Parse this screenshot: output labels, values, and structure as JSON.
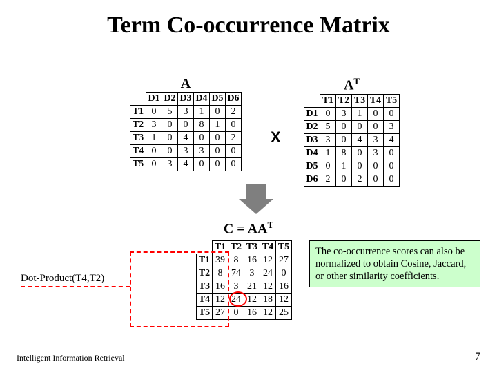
{
  "title": "Term Co-occurrence Matrix",
  "labels": {
    "A": "A",
    "AT_html": "A",
    "AT_sup": "T",
    "x": "X",
    "C_prefix": "C =  A",
    "C_middle": "A",
    "C_sup": "T",
    "dotprod": "Dot-Product(T4,T2)",
    "note": "The co-occurrence scores can also be normalized to obtain Cosine, Jaccard, or other similarity coefficients.",
    "footer_left": "Intelligent Information Retrieval",
    "footer_right": "7"
  },
  "matrixA": {
    "col_headers": [
      "D1",
      "D2",
      "D3",
      "D4",
      "D5",
      "D6"
    ],
    "row_headers": [
      "T1",
      "T2",
      "T3",
      "T4",
      "T5"
    ],
    "rows": [
      [
        0,
        5,
        3,
        1,
        0,
        2
      ],
      [
        3,
        0,
        0,
        8,
        1,
        0
      ],
      [
        1,
        0,
        4,
        0,
        0,
        2
      ],
      [
        0,
        0,
        3,
        3,
        0,
        0
      ],
      [
        0,
        3,
        4,
        0,
        0,
        0
      ]
    ]
  },
  "matrixAT": {
    "col_headers": [
      "T1",
      "T2",
      "T3",
      "T4",
      "T5"
    ],
    "row_headers": [
      "D1",
      "D2",
      "D3",
      "D4",
      "D5",
      "D6"
    ],
    "rows": [
      [
        0,
        3,
        1,
        0,
        0
      ],
      [
        5,
        0,
        0,
        0,
        3
      ],
      [
        3,
        0,
        4,
        3,
        4
      ],
      [
        1,
        8,
        0,
        3,
        0
      ],
      [
        0,
        1,
        0,
        0,
        0
      ],
      [
        2,
        0,
        2,
        0,
        0
      ]
    ]
  },
  "matrixC": {
    "col_headers": [
      "T1",
      "T2",
      "T3",
      "T4",
      "T5"
    ],
    "row_headers": [
      "T1",
      "T2",
      "T3",
      "T4",
      "T5"
    ],
    "rows": [
      [
        39,
        8,
        16,
        12,
        27
      ],
      [
        8,
        74,
        3,
        24,
        0
      ],
      [
        16,
        3,
        21,
        12,
        16
      ],
      [
        12,
        24,
        12,
        18,
        12
      ],
      [
        27,
        0,
        16,
        12,
        25
      ]
    ]
  }
}
